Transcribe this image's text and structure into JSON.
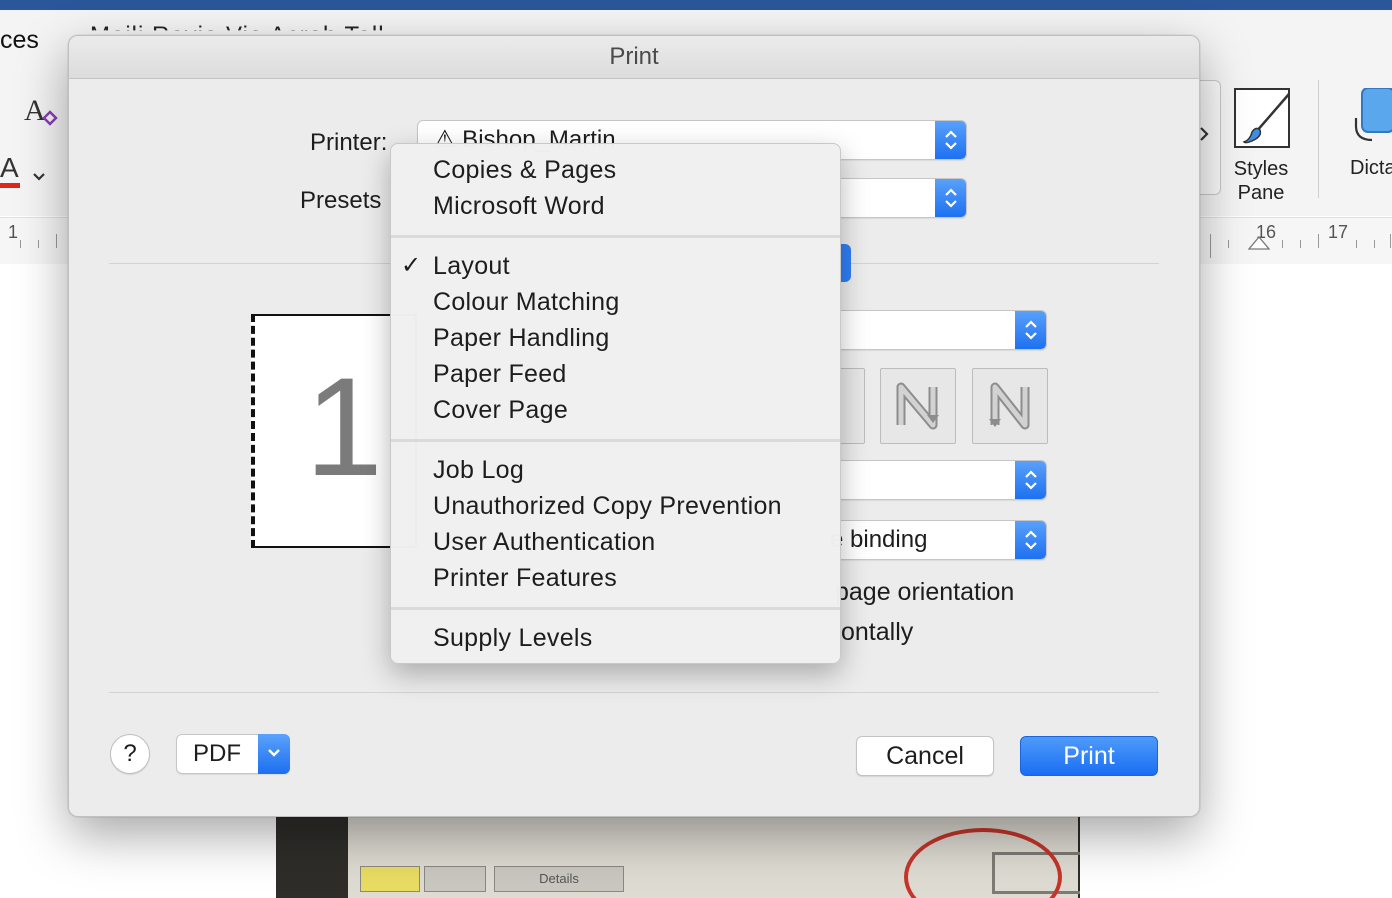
{
  "background": {
    "ribbon_partial_text": "ces",
    "ribbon_tabs_partial": "Maili     Revie     Vie     Acrob     Tell",
    "font_color_glyph": "A",
    "styles_pane_label": "Styles Pane",
    "dictate_label": "Dicta",
    "ruler_numbers": [
      "1",
      "16",
      "17"
    ],
    "photo_details_label": "Details"
  },
  "dialog": {
    "title": "Print",
    "printer_label": "Printer:",
    "printer_value": "⚠ Bishop_Martin",
    "presets_label": "Presets",
    "preview_page_number": "1",
    "binding_partial": "e binding",
    "page_orientation_partial": "page orientation",
    "horizontally_partial": "ontally",
    "help_label": "?",
    "pdf_label": "PDF",
    "cancel_label": "Cancel",
    "print_label": "Print"
  },
  "menu": {
    "groups": [
      {
        "items": [
          {
            "label": "Copies & Pages"
          },
          {
            "label": "Microsoft Word"
          }
        ]
      },
      {
        "items": [
          {
            "label": "Layout",
            "checked": true
          },
          {
            "label": "Colour Matching"
          },
          {
            "label": "Paper Handling"
          },
          {
            "label": "Paper Feed"
          },
          {
            "label": "Cover Page"
          }
        ]
      },
      {
        "items": [
          {
            "label": "Job Log"
          },
          {
            "label": "Unauthorized Copy Prevention"
          },
          {
            "label": "User Authentication"
          },
          {
            "label": "Printer Features"
          }
        ]
      },
      {
        "items": [
          {
            "label": "Supply Levels"
          }
        ]
      }
    ],
    "check_glyph": "✓"
  },
  "colors": {
    "accent_blue": "#1d6ff0",
    "word_blue": "#2b579a"
  }
}
